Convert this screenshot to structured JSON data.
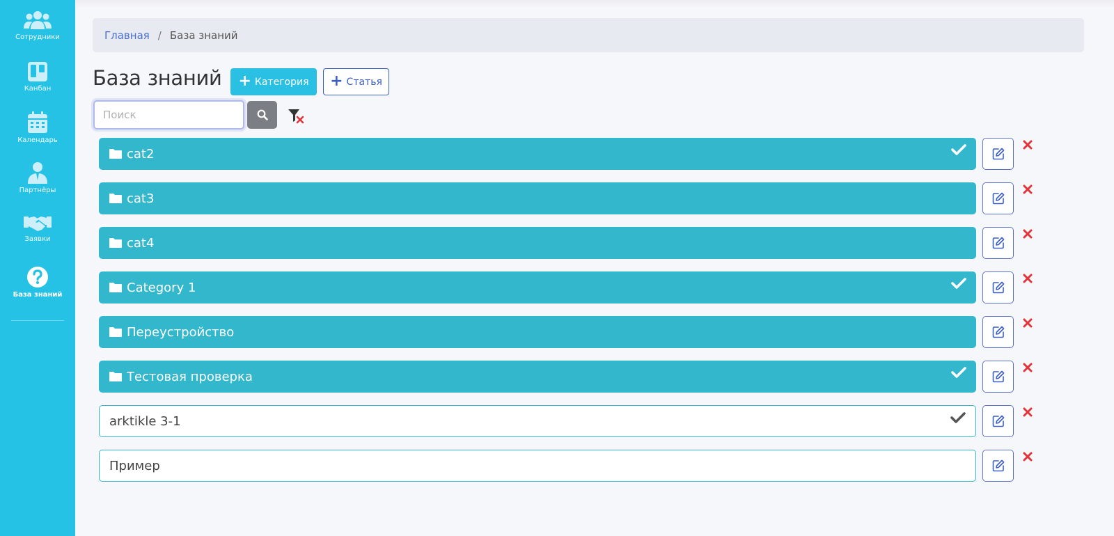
{
  "sidebar": {
    "items": [
      {
        "label": "Сотрудники",
        "icon": "users-icon"
      },
      {
        "label": "Канбан",
        "icon": "kanban-icon"
      },
      {
        "label": "Календарь",
        "icon": "calendar-icon"
      },
      {
        "label": "Партнёры",
        "icon": "partner-icon"
      },
      {
        "label": "Заявки",
        "icon": "handshake-icon"
      },
      {
        "label": "База знаний",
        "icon": "question-circle-icon"
      }
    ],
    "active_index": 5
  },
  "breadcrumb": {
    "home": "Главная",
    "separator": "/",
    "current": "База знаний"
  },
  "page": {
    "title": "База знаний",
    "add_category_label": "Категория",
    "add_article_label": "Статья"
  },
  "search": {
    "placeholder": "Поиск",
    "value": ""
  },
  "items": [
    {
      "name": "cat2",
      "type": "category",
      "checked": true
    },
    {
      "name": "cat3",
      "type": "category",
      "checked": false
    },
    {
      "name": "cat4",
      "type": "category",
      "checked": false
    },
    {
      "name": "Category 1",
      "type": "category",
      "checked": true
    },
    {
      "name": "Переустройство",
      "type": "category",
      "checked": false
    },
    {
      "name": "Тестовая проверка",
      "type": "category",
      "checked": true
    },
    {
      "name": "arktikle 3-1",
      "type": "article",
      "checked": true
    },
    {
      "name": "Пример",
      "type": "article",
      "checked": false
    }
  ],
  "colors": {
    "sidebar": "#26c2e6",
    "category_row": "#33b7cd",
    "primary_outline": "#3b5fc4",
    "delete": "#e0353d"
  }
}
